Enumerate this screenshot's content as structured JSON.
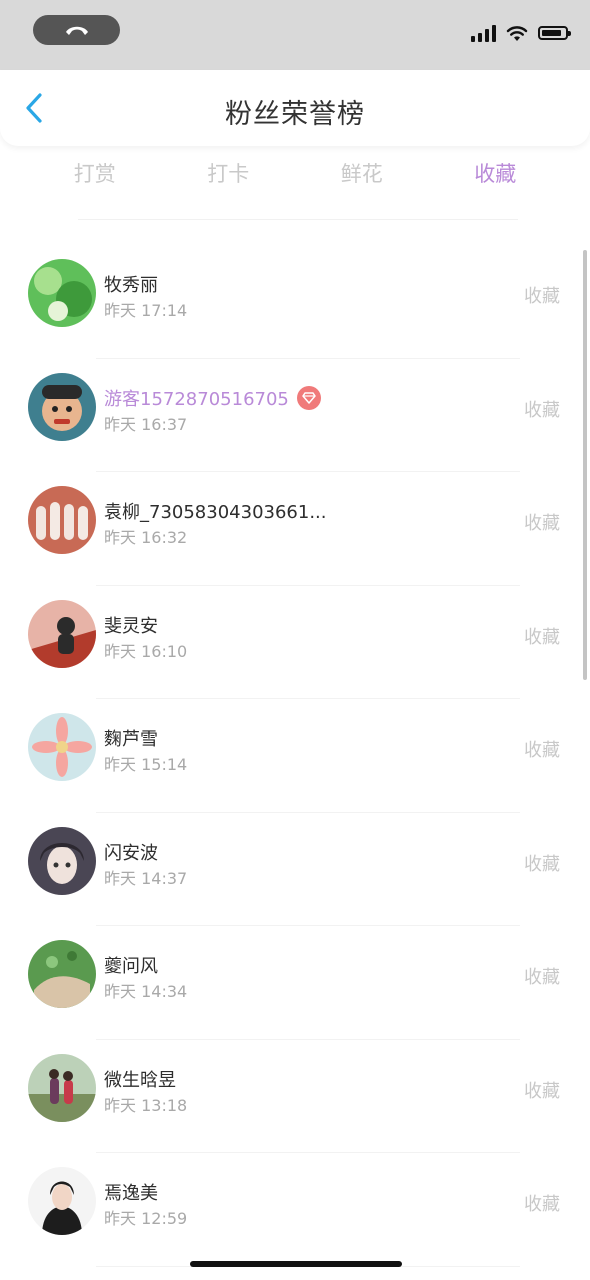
{
  "header": {
    "title": "粉丝荣誉榜"
  },
  "tabs": [
    {
      "label": "打赏",
      "active": false
    },
    {
      "label": "打卡",
      "active": false
    },
    {
      "label": "鲜花",
      "active": false
    },
    {
      "label": "收藏",
      "active": true
    }
  ],
  "colors": {
    "accent": "#b98ad8",
    "back": "#2aa7e6",
    "vip_badge": "#f07a7a"
  },
  "fans": [
    {
      "name": "牧秀丽",
      "time": "昨天 17:14",
      "action": "收藏",
      "vip": false
    },
    {
      "name": "游客1572870516705",
      "time": "昨天 16:37",
      "action": "收藏",
      "vip": true
    },
    {
      "name": "袁柳_73058304303661...",
      "time": "昨天 16:32",
      "action": "收藏",
      "vip": false
    },
    {
      "name": "斐灵安",
      "time": "昨天 16:10",
      "action": "收藏",
      "vip": false
    },
    {
      "name": "麴芦雪",
      "time": "昨天 15:14",
      "action": "收藏",
      "vip": false
    },
    {
      "name": "闪安波",
      "time": "昨天 14:37",
      "action": "收藏",
      "vip": false
    },
    {
      "name": "夔问风",
      "time": "昨天 14:34",
      "action": "收藏",
      "vip": false
    },
    {
      "name": "微生晗昱",
      "time": "昨天 13:18",
      "action": "收藏",
      "vip": false
    },
    {
      "name": "焉逸美",
      "time": "昨天 12:59",
      "action": "收藏",
      "vip": false
    }
  ]
}
